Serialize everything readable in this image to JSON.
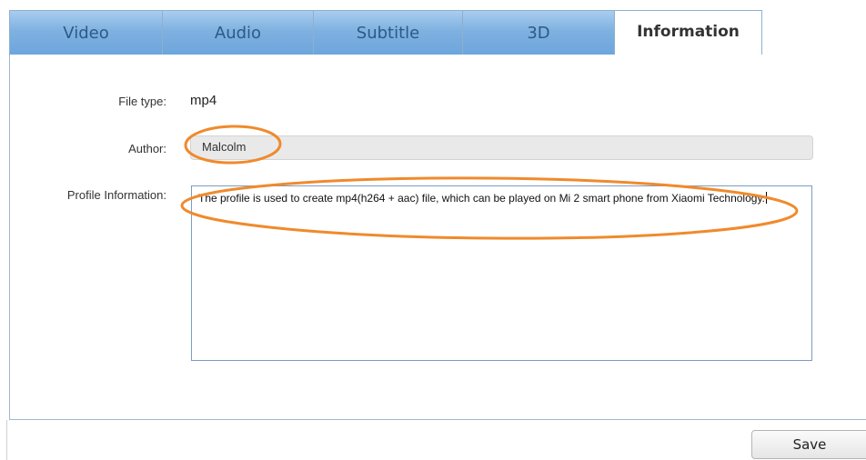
{
  "tabs": [
    {
      "label": "Video",
      "active": false
    },
    {
      "label": "Audio",
      "active": false
    },
    {
      "label": "Subtitle",
      "active": false
    },
    {
      "label": "3D",
      "active": false
    },
    {
      "label": "Information",
      "active": true
    }
  ],
  "form": {
    "file_type_label": "File type:",
    "file_type_value": "mp4",
    "author_label": "Author:",
    "author_value": "Malcolm",
    "profile_label": "Profile Information:",
    "profile_value": "The profile is used to create mp4(h264 + aac) file, which can be played on Mi 2 smart phone from Xiaomi Technology."
  },
  "footer": {
    "save_label": "Save"
  },
  "colors": {
    "tab_gradient_top": "#a9cdee",
    "tab_gradient_bottom": "#6da5dc",
    "tab_text": "#2d5a86",
    "annotation": "#f08a2c"
  }
}
